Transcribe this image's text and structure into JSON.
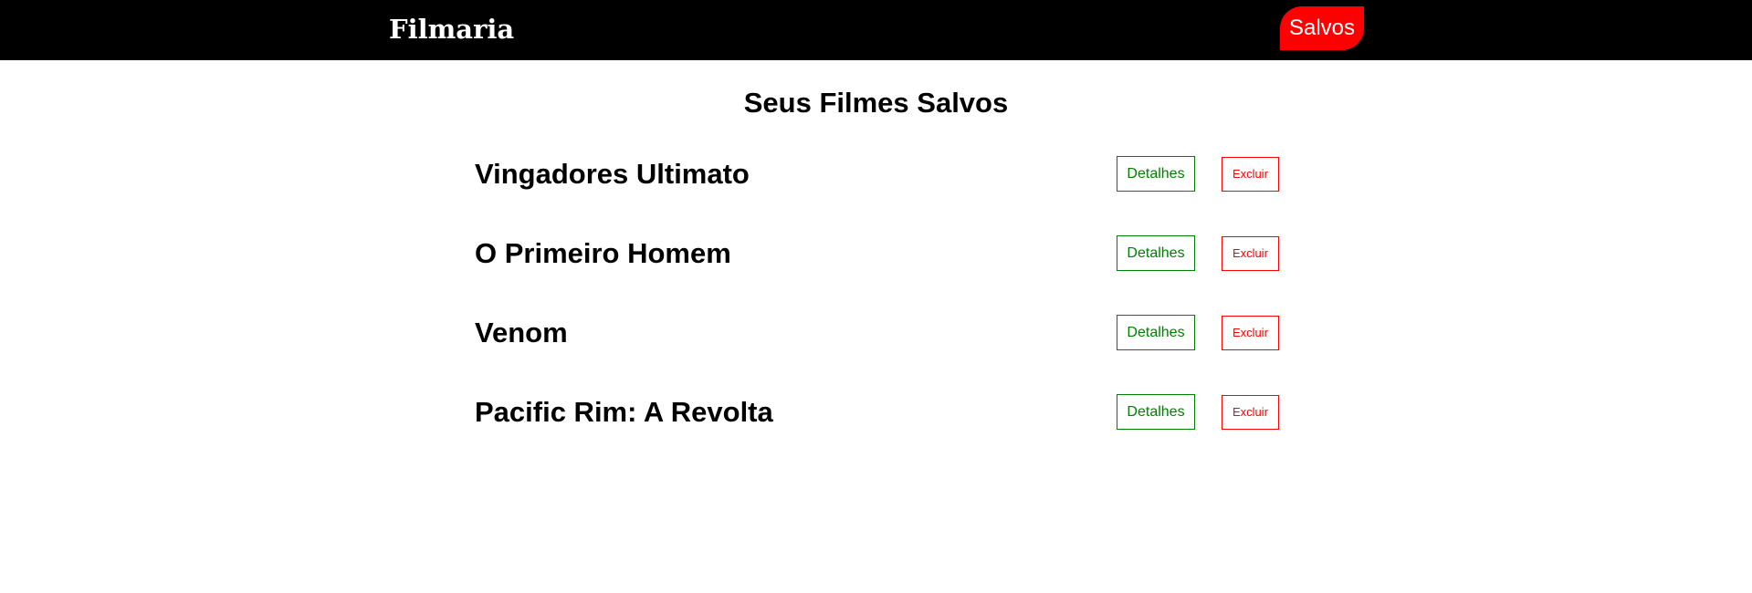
{
  "header": {
    "logo": "Filmaria",
    "saved_link": "Salvos",
    "background_color": "#000000",
    "saved_link_color": "#ff0000"
  },
  "main": {
    "title": "Seus Filmes Salvos",
    "movies": [
      {
        "title": "Vingadores Ultimato",
        "details_label": "Detalhes",
        "delete_label": "Excluir"
      },
      {
        "title": "O Primeiro Homem",
        "details_label": "Detalhes",
        "delete_label": "Excluir"
      },
      {
        "title": "Venom",
        "details_label": "Detalhes",
        "delete_label": "Excluir"
      },
      {
        "title": "Pacific Rim: A Revolta",
        "details_label": "Detalhes",
        "delete_label": "Excluir"
      }
    ],
    "details_color": "#008000",
    "delete_color": "#ff0000"
  }
}
